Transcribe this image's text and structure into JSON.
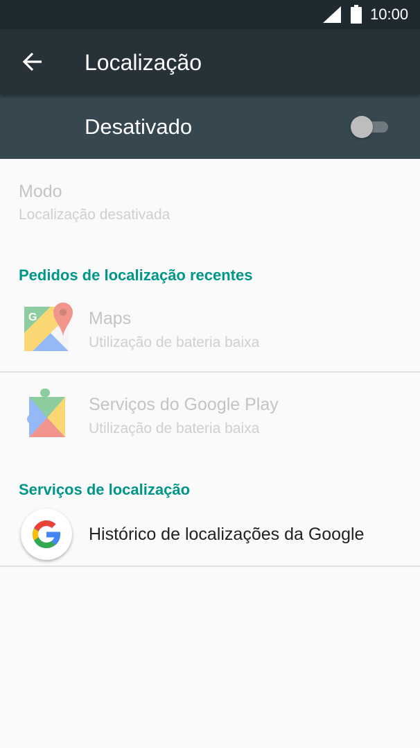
{
  "status_bar": {
    "time": "10:00"
  },
  "app_bar": {
    "title": "Localização"
  },
  "master_switch": {
    "label": "Desativado",
    "on": false
  },
  "mode": {
    "title": "Modo",
    "summary": "Localização desativada"
  },
  "recent_requests": {
    "header": "Pedidos de localização recentes",
    "items": [
      {
        "title": "Maps",
        "summary": "Utilização de bateria baixa",
        "icon": "maps-icon"
      },
      {
        "title": "Serviços do Google Play",
        "summary": "Utilização de bateria baixa",
        "icon": "play-services-icon"
      }
    ]
  },
  "location_services": {
    "header": "Serviços de localização",
    "items": [
      {
        "title": "Histórico de localizações da Google",
        "icon": "google-icon"
      }
    ]
  },
  "colors": {
    "status_bar": "#1f2a30",
    "app_bar": "#263238",
    "switch_bar": "#37474f",
    "accent": "#009688",
    "background": "#fafafa"
  }
}
